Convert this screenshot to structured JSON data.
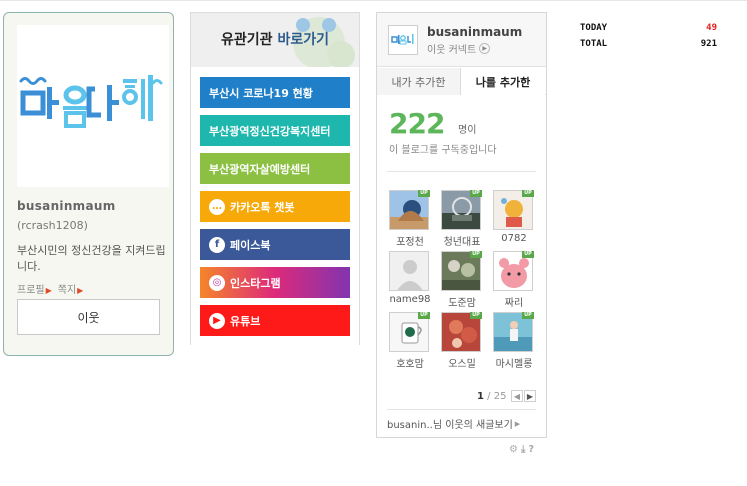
{
  "profile": {
    "logo_text": "마음다해",
    "name": "busaninmaum",
    "user_id": "(rcrash1208)",
    "description": "부산시민의 정신건강을 지켜드립니다.",
    "links": [
      "프로필",
      "쪽지"
    ],
    "neighbor_button": "이웃"
  },
  "orgs": {
    "title_prefix": "유관기관 ",
    "title_accent": "바로가기",
    "buttons": [
      {
        "label": "부산시 코로나19 현황",
        "color": "#1f7fc8",
        "icon": ""
      },
      {
        "label": "부산광역정신건강복지센터",
        "color": "#1eb7ad",
        "icon": ""
      },
      {
        "label": "부산광역자살예방센터",
        "color": "#8cc043",
        "icon": ""
      },
      {
        "label": "카카오톡 챗봇",
        "color": "#f7a90a",
        "icon": "chat-bubble-icon"
      },
      {
        "label": "페이스북",
        "color": "#3b5998",
        "icon": "facebook-icon"
      },
      {
        "label": "인스타그램",
        "color": "#c536a4",
        "icon": "instagram-icon"
      },
      {
        "label": "유튜브",
        "color": "#ff1a1a",
        "icon": "youtube-icon"
      }
    ]
  },
  "neighbors": {
    "blog_name": "busaninmaum",
    "connect_label": "이웃 커넥트",
    "tabs": [
      "내가 추가한",
      "나를 추가한"
    ],
    "count": "222",
    "count_unit": "명이",
    "subtitle": "이 블로그를 구독중입니다",
    "items": [
      {
        "label": "포정천",
        "up": "UP"
      },
      {
        "label": "청년대표",
        "up": "UP"
      },
      {
        "label": "0782",
        "up": "UP"
      },
      {
        "label": "name98",
        "up": ""
      },
      {
        "label": "도준맘",
        "up": "UP"
      },
      {
        "label": "짜리",
        "up": "UP"
      },
      {
        "label": "호호맘",
        "up": "UP"
      },
      {
        "label": "오스밀",
        "up": "UP"
      },
      {
        "label": "마시멜롱",
        "up": "UP"
      }
    ],
    "pager_current": "1",
    "pager_total": "/ 25",
    "footer": "busanin..님 이웃의 새글보기"
  },
  "counter": {
    "today_label": "TODAY",
    "today_value": "49",
    "total_label": "TOTAL",
    "total_value": "921"
  }
}
